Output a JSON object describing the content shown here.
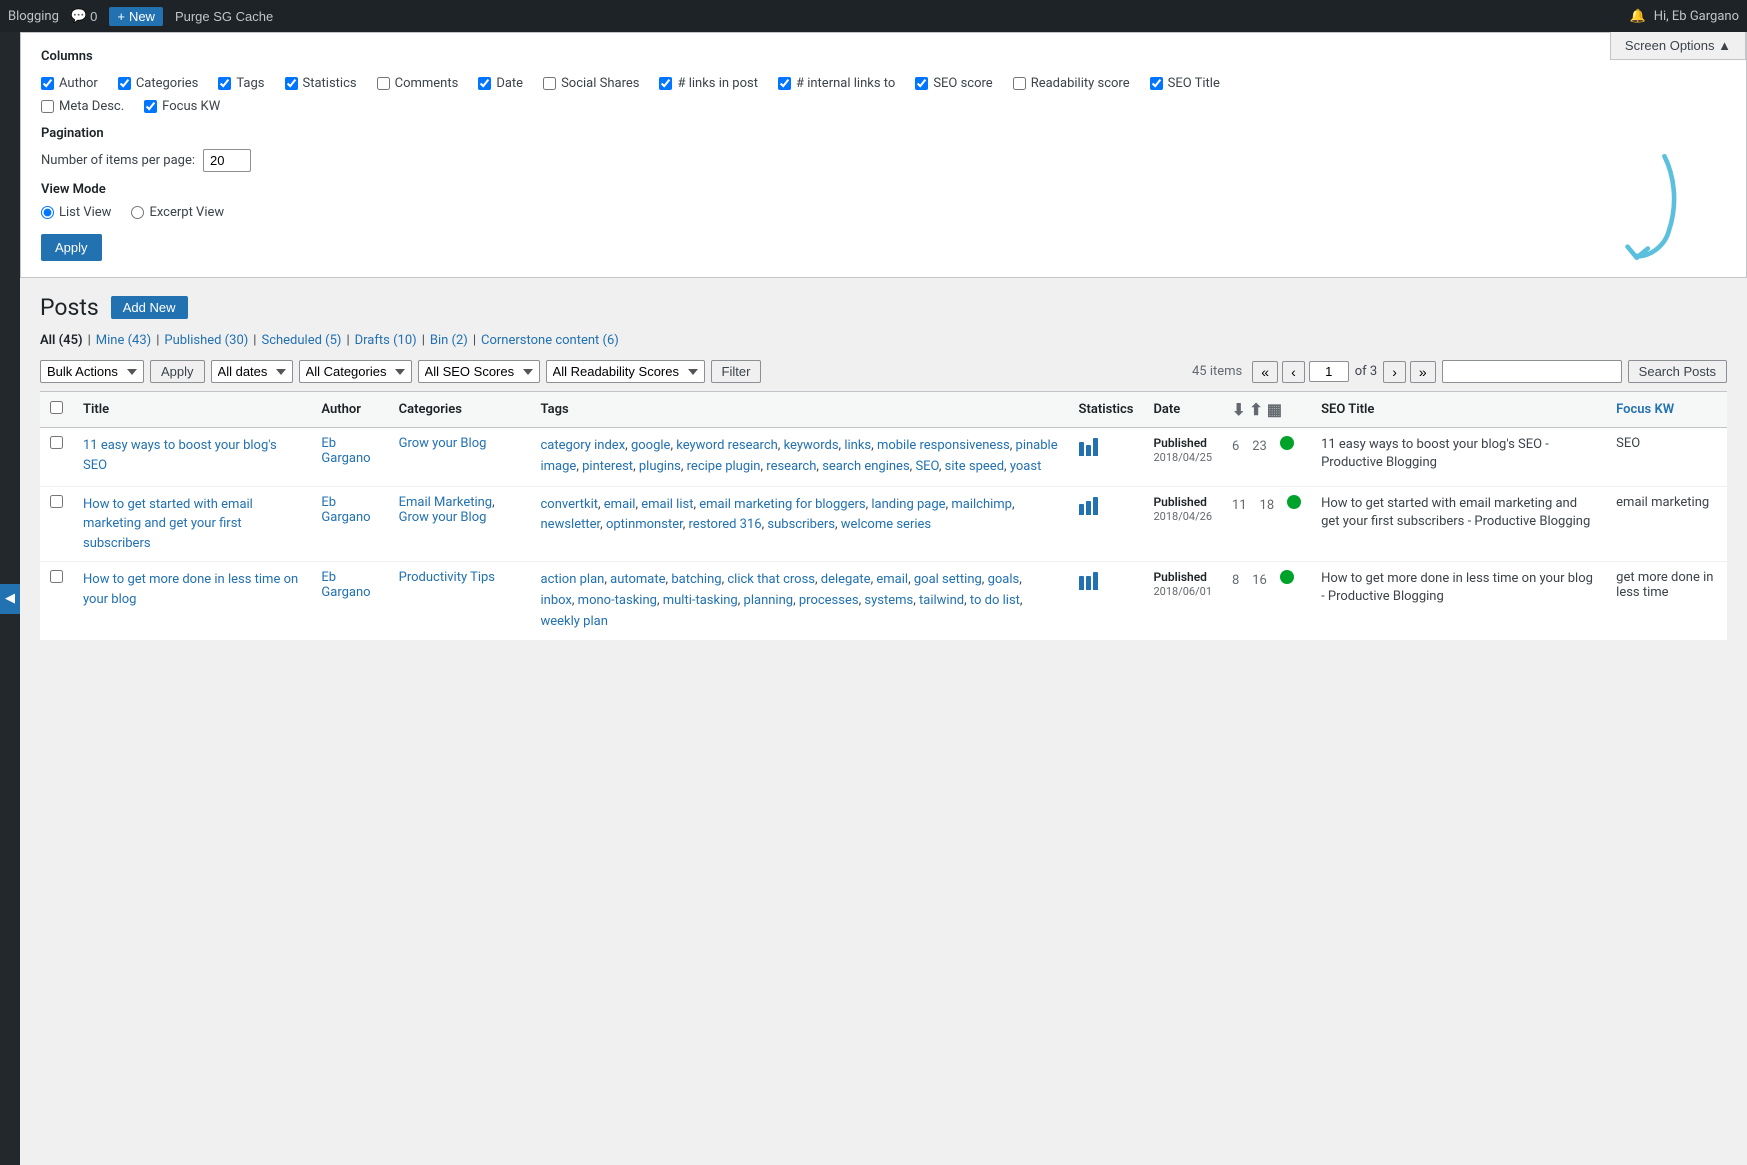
{
  "adminBar": {
    "siteName": "Blogging",
    "commentsLabel": "0",
    "newLabel": "New",
    "cacheLabel": "Purge SG Cache",
    "notificationsLabel": "Hi, Eb Gargano",
    "notificationsIcon": "🔔"
  },
  "screenOptions": {
    "title": "Columns",
    "columns": [
      {
        "id": "author",
        "label": "Author",
        "checked": true
      },
      {
        "id": "categories",
        "label": "Categories",
        "checked": true
      },
      {
        "id": "tags",
        "label": "Tags",
        "checked": true
      },
      {
        "id": "statistics",
        "label": "Statistics",
        "checked": true
      },
      {
        "id": "comments",
        "label": "Comments",
        "checked": false
      },
      {
        "id": "date",
        "label": "Date",
        "checked": true
      },
      {
        "id": "social_shares",
        "label": "Social Shares",
        "checked": false
      },
      {
        "id": "links_in_post",
        "label": "# links in post",
        "checked": true
      },
      {
        "id": "internal_links_to",
        "label": "# internal links to",
        "checked": true
      },
      {
        "id": "seo_score",
        "label": "SEO score",
        "checked": true
      },
      {
        "id": "readability_score",
        "label": "Readability score",
        "checked": false
      },
      {
        "id": "seo_title",
        "label": "SEO Title",
        "checked": true
      },
      {
        "id": "meta_desc",
        "label": "Meta Desc.",
        "checked": false
      },
      {
        "id": "focus_kw",
        "label": "Focus KW",
        "checked": true
      }
    ],
    "pagination": {
      "label": "Number of items per page:",
      "value": "20"
    },
    "viewMode": {
      "label": "View Mode",
      "options": [
        {
          "id": "list_view",
          "label": "List View",
          "checked": true
        },
        {
          "id": "excerpt_view",
          "label": "Excerpt View",
          "checked": false
        }
      ]
    },
    "applyBtn": "Apply",
    "screenOptionsBtn": "Screen Options ▲"
  },
  "postsArea": {
    "title": "Posts",
    "addNewBtn": "Add New",
    "filterLinks": [
      {
        "label": "All (45)",
        "active": true,
        "href": "#"
      },
      {
        "label": "Mine (43)",
        "active": false,
        "href": "#"
      },
      {
        "label": "Published (30)",
        "active": false,
        "href": "#"
      },
      {
        "label": "Scheduled (5)",
        "active": false,
        "href": "#"
      },
      {
        "label": "Drafts (10)",
        "active": false,
        "href": "#"
      },
      {
        "label": "Bin (2)",
        "active": false,
        "href": "#"
      },
      {
        "label": "Cornerstone content (6)",
        "active": false,
        "href": "#"
      }
    ],
    "tableControls": {
      "bulkActions": "Bulk Actions",
      "applyBtn": "Apply",
      "allDates": "All dates",
      "allCategories": "All Categories",
      "allSeoScores": "All SEO Scores",
      "allReadabilityScores": "All Readability Scores",
      "filterBtn": "Filter",
      "searchBtn": "Search Posts",
      "searchPlaceholder": "",
      "itemsCount": "45 items",
      "firstPage": "«",
      "prevPage": "‹",
      "currentPage": "1",
      "ofText": "of",
      "totalPages": "3",
      "nextPage": "›",
      "lastPage": "»"
    },
    "tableHeaders": [
      {
        "label": "Title",
        "sortable": false
      },
      {
        "label": "Author",
        "sortable": false
      },
      {
        "label": "Categories",
        "sortable": false
      },
      {
        "label": "Tags",
        "sortable": false
      },
      {
        "label": "Statistics",
        "sortable": false
      },
      {
        "label": "Date",
        "sortable": false
      },
      {
        "label": "",
        "sortable": false,
        "isExport": true
      },
      {
        "label": "SEO Title",
        "sortable": false
      },
      {
        "label": "Focus KW",
        "sortable": false,
        "isLink": true
      }
    ],
    "rows": [
      {
        "title": "11 easy ways to boost your blog's SEO",
        "author": "Eb Gargano",
        "categories": "Grow your Blog",
        "tags": "category index, google, keyword research, keywords, links, mobile responsiveness, pinable image, pinterest, plugins, recipe plugin, research, search engines, SEO, site speed, yoast",
        "stats_bars": [
          4,
          3,
          5
        ],
        "dateStatus": "Published",
        "dateValue": "2018/04/25",
        "linksInPost": "6",
        "internalLinks": "23",
        "seoScore": "green",
        "seoTitle": "11 easy ways to boost your blog's SEO - Productive Blogging",
        "focusKW": "SEO"
      },
      {
        "title": "How to get started with email marketing and get your first subscribers",
        "author": "Eb Gargano",
        "categories": "Email Marketing, Grow your Blog",
        "tags": "convertkit, email, email list, email marketing for bloggers, landing page, mailchimp, newsletter, optinmonster, restored 316, subscribers, welcome series",
        "stats_bars": [
          3,
          4,
          5
        ],
        "dateStatus": "Published",
        "dateValue": "2018/04/26",
        "linksInPost": "11",
        "internalLinks": "18",
        "seoScore": "green",
        "seoTitle": "How to get started with email marketing and get your first subscribers - Productive Blogging",
        "focusKW": "email marketing"
      },
      {
        "title": "How to get more done in less time on your blog",
        "author": "Eb Gargano",
        "categories": "Productivity Tips",
        "tags": "action plan, automate, batching, click that cross, delegate, email, goal setting, goals, inbox, mono-tasking, multi-tasking, planning, processes, systems, tailwind, to do list, weekly plan",
        "stats_bars": [
          3,
          3,
          4
        ],
        "dateStatus": "Published",
        "dateValue": "2018/06/01",
        "linksInPost": "8",
        "internalLinks": "16",
        "seoScore": "green",
        "seoTitle": "How to get more done in less time on your blog - Productive Blogging",
        "focusKW": "get more done in less time"
      }
    ]
  }
}
